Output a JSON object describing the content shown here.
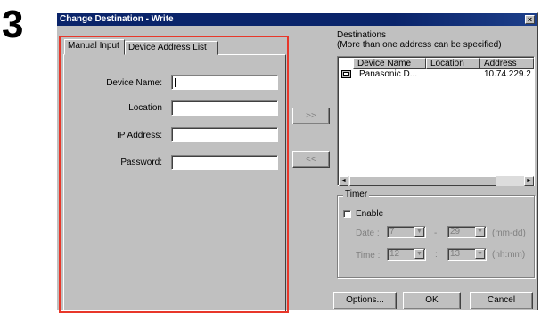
{
  "step_number": "3",
  "window": {
    "title": "Change Destination - Write",
    "close_glyph": "×"
  },
  "tabs": [
    {
      "label": "Manual Input",
      "active": true
    },
    {
      "label": "Device Address List",
      "active": false
    }
  ],
  "form": {
    "device_name_label": "Device Name:",
    "location_label": "Location",
    "ip_label": "IP Address:",
    "password_label": "Password:",
    "device_name_value": "",
    "location_value": "",
    "ip_value": "",
    "password_value": ""
  },
  "move": {
    "add_label": ">>",
    "remove_label": "<<"
  },
  "destinations": {
    "heading_line1": "Destinations",
    "heading_line2": "(More than one address can be specified)",
    "columns": [
      "Device Name",
      "Location",
      "Address"
    ],
    "rows": [
      {
        "icon": "computer-icon",
        "device_name": "Panasonic D...",
        "location": "",
        "address": "10.74.229.2"
      }
    ],
    "scroll_left_glyph": "◄",
    "scroll_right_glyph": "►"
  },
  "timer": {
    "title": "Timer",
    "enable_label": "Enable",
    "enable_checked": false,
    "date_label": "Date :",
    "date_month": "7",
    "date_sep": "-",
    "date_day": "29",
    "date_format": "(mm-dd)",
    "time_label": "Time :",
    "time_hour": "12",
    "time_sep": ":",
    "time_minute": "13",
    "time_format": "(hh:mm)",
    "dropdown_glyph": "▼"
  },
  "footer": {
    "options_label": "Options...",
    "ok_label": "OK",
    "cancel_label": "Cancel"
  },
  "colors": {
    "title_bar": "#0a246a",
    "highlight_frame": "#e8372a",
    "dialog_face": "#c0c0c0"
  }
}
